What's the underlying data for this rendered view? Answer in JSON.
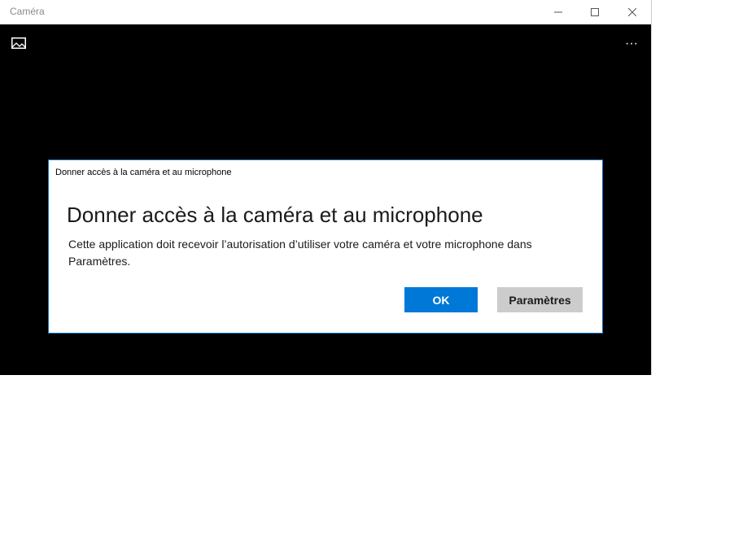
{
  "window": {
    "title": "Caméra",
    "icons": {
      "minimize": "minimize-icon",
      "maximize": "maximize-icon",
      "close": "close-icon"
    }
  },
  "toolbar": {
    "gallery_icon": "gallery-icon",
    "more_label": "···"
  },
  "dialog": {
    "caption": "Donner accès à la caméra et au microphone",
    "heading": "Donner accès à la caméra et au microphone",
    "body": "Cette application doit recevoir l’autorisation d’utiliser votre caméra et votre microphone dans Paramètres.",
    "ok_label": "OK",
    "settings_label": "Paramètres"
  },
  "colors": {
    "accent": "#0078d7",
    "dialog_border": "#1979ca",
    "secondary_button": "#cccccc",
    "viewfinder": "#000000"
  }
}
